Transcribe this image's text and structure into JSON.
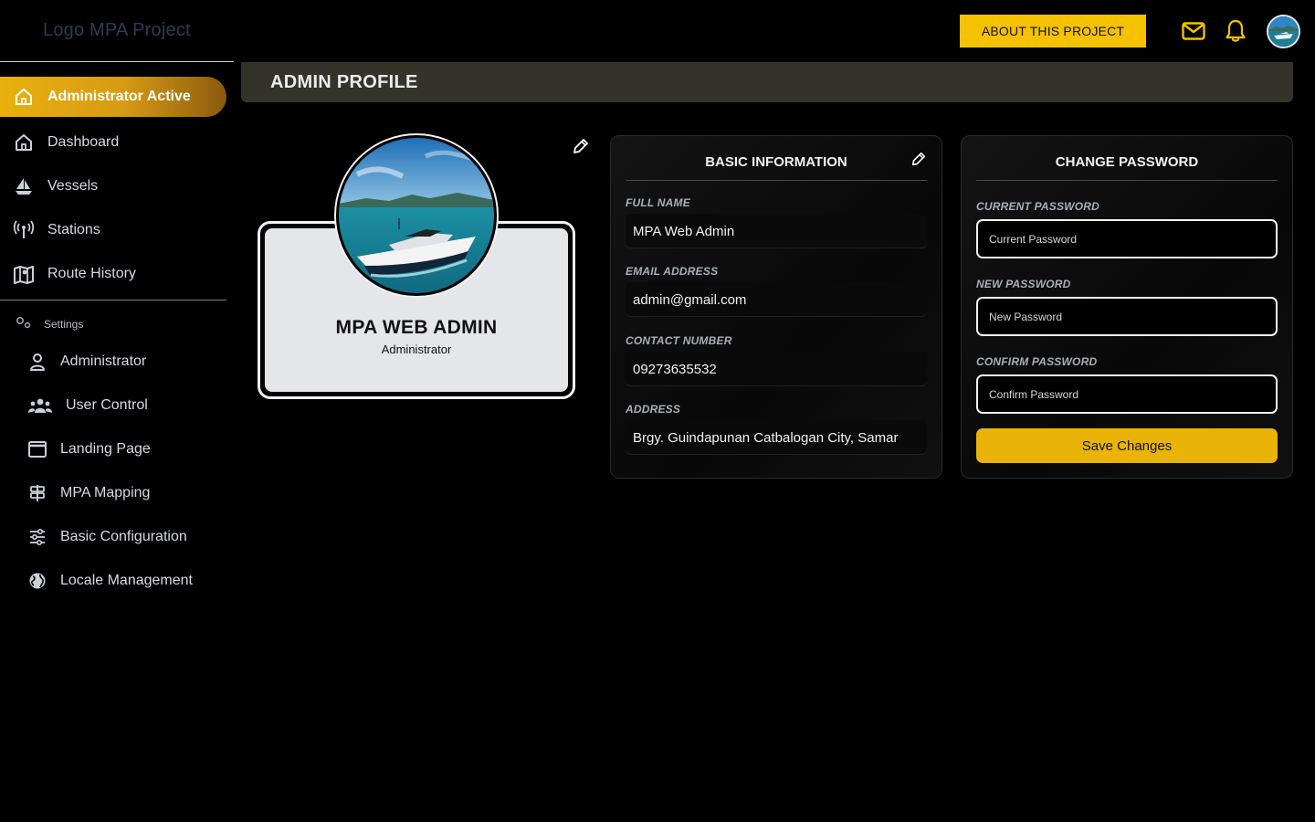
{
  "app": {
    "logo_text": "Logo MPA Project",
    "about_button": "ABOUT THIS PROJECT"
  },
  "colors": {
    "accent": "#f5c200",
    "active_gradient_start": "#e9b10c",
    "active_gradient_end": "#8a5a0e",
    "header_band": "#33332a"
  },
  "sidebar": {
    "items": [
      {
        "label": "Administrator Active",
        "icon": "home-icon",
        "active": true
      },
      {
        "label": "Dashboard",
        "icon": "home-icon"
      },
      {
        "label": "Vessels",
        "icon": "sailboat-icon"
      },
      {
        "label": "Stations",
        "icon": "antenna-icon"
      },
      {
        "label": "Route History",
        "icon": "map-icon"
      }
    ],
    "settings_label": "Settings",
    "settings_items": [
      {
        "label": "Administrator",
        "icon": "user-icon"
      },
      {
        "label": "User Control",
        "icon": "users-icon"
      },
      {
        "label": "Landing Page",
        "icon": "window-icon"
      },
      {
        "label": "MPA Mapping",
        "icon": "signpost-icon"
      },
      {
        "label": "Basic Configuration",
        "icon": "sliders-icon"
      },
      {
        "label": "Locale Management",
        "icon": "globe-icon"
      }
    ]
  },
  "page": {
    "title": "ADMIN PROFILE"
  },
  "profile": {
    "name": "MPA WEB ADMIN",
    "role": "Administrator"
  },
  "basic_info": {
    "title": "BASIC INFORMATION",
    "fields": [
      {
        "label": "FULL NAME",
        "value": "MPA Web Admin"
      },
      {
        "label": "EMAIL ADDRESS",
        "value": "admin@gmail.com"
      },
      {
        "label": "CONTACT NUMBER",
        "value": "09273635532"
      },
      {
        "label": "ADDRESS",
        "value": "Brgy. Guindapunan Catbalogan City, Samar"
      }
    ]
  },
  "change_password": {
    "title": "CHANGE PASSWORD",
    "current_label": "CURRENT PASSWORD",
    "current_placeholder": "Current Password",
    "new_label": "NEW PASSWORD",
    "new_placeholder": "New Password",
    "confirm_label": "CONFIRM PASSWORD",
    "confirm_placeholder": "Confirm Password",
    "save_button": "Save Changes"
  }
}
